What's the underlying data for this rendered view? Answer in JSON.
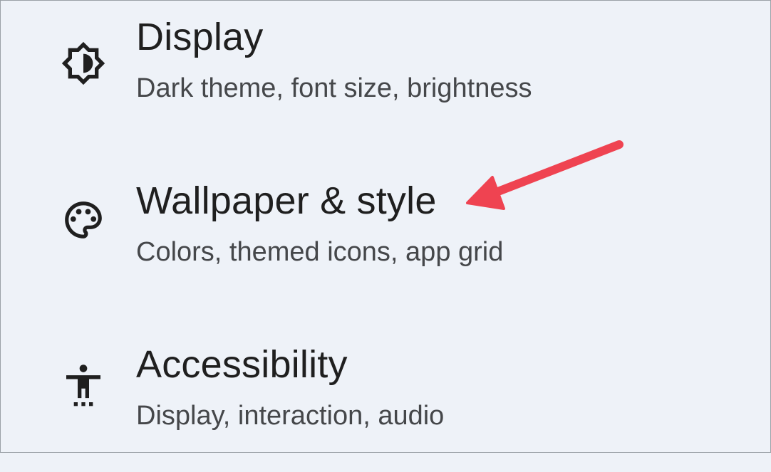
{
  "settings": {
    "items": [
      {
        "id": "display",
        "icon": "brightness-icon",
        "title": "Display",
        "subtitle": "Dark theme, font size, brightness"
      },
      {
        "id": "wallpaper",
        "icon": "palette-icon",
        "title": "Wallpaper & style",
        "subtitle": "Colors, themed icons, app grid"
      },
      {
        "id": "accessibility",
        "icon": "accessibility-icon",
        "title": "Accessibility",
        "subtitle": "Display, interaction, audio"
      }
    ]
  },
  "colors": {
    "background": "#eef2f8",
    "title_text": "#1f1f1f",
    "subtitle_text": "#45474a",
    "icon": "#1f1f1f",
    "annotation_arrow": "#ef4351"
  },
  "annotation": {
    "type": "arrow",
    "target": "wallpaper"
  }
}
